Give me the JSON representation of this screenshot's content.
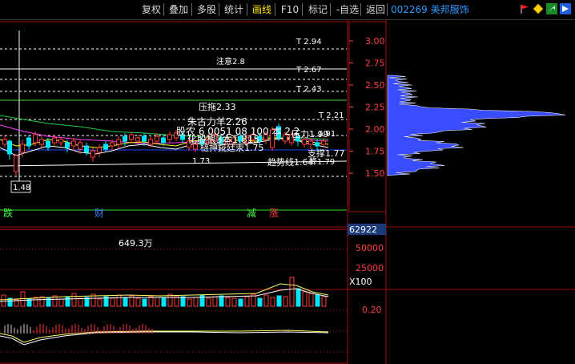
{
  "toolbar": {
    "buttons": [
      "复权",
      "叠加",
      "多股",
      "统计",
      "画线",
      "F10",
      "标记",
      "-自选",
      "返回"
    ],
    "active_index": 4,
    "stock_title": "002269 美邦服饰",
    "icons": [
      "red-flag-icon",
      "diamond-icon",
      "green-arrow-icon",
      "blue-arrow-icon"
    ]
  },
  "price_axis": {
    "ticks": [
      "3.00",
      "2.75",
      "2.50",
      "2.25",
      "2.00",
      "1.75",
      "1.50"
    ],
    "values": [
      3.0,
      2.75,
      2.5,
      2.25,
      2.0,
      1.75,
      1.5
    ]
  },
  "annotations": {
    "t294": "T 2.94",
    "zhuyi": "注意2.8",
    "t267": "T 2.67",
    "t243": "T 2.43",
    "t221": "T 2.21",
    "yazhi": "压拖2.33",
    "zhugeli": "朱古力羊2.26",
    "gubang": "股农 6 0051 08 100 本 2.2",
    "huaban": "化股根3本1.815",
    "yali": "压力1.99",
    "t191": "1.91",
    "lianpu": "梿抻錵廷汞1.75",
    "zhicheng": "支撑1.77",
    "p173": "1.73",
    "qushi": "趋势线1.64",
    "jiang": "降1.79",
    "low": "1.48"
  },
  "event_labels": {
    "die": "跌",
    "cai": "财",
    "jian": "减",
    "zhang": "涨"
  },
  "volume": {
    "header_value": "62922",
    "max_label": "649.3万",
    "ticks": [
      "50000",
      "25000"
    ],
    "unit": "X100"
  },
  "indicator": {
    "ticks": [
      "0.20"
    ]
  },
  "colors": {
    "up": "#ff3a3a",
    "down": "#00e5ff",
    "grid": "#a01010",
    "axis_text": "#ff4040",
    "profile": "#3a4cff"
  }
}
